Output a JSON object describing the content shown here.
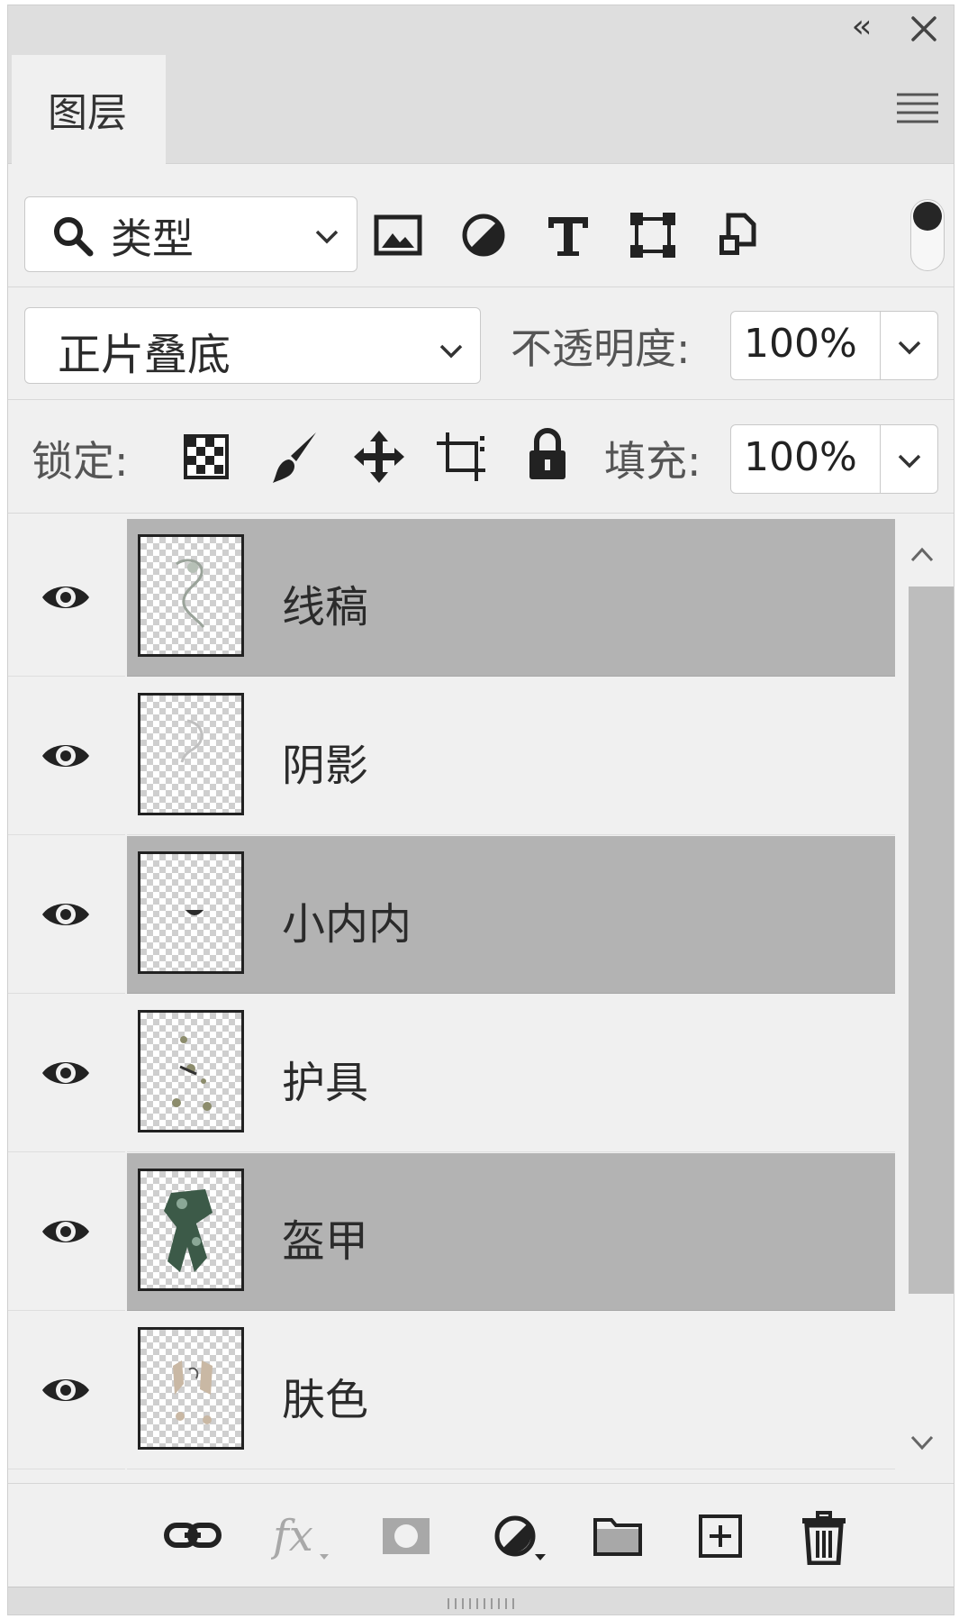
{
  "panel": {
    "collapse_icon": "double-chevron-left-icon",
    "close_icon": "close-icon",
    "tab_label": "图层",
    "menu_icon": "hamburger-menu-icon"
  },
  "filter": {
    "kind_label": "类型",
    "icons": [
      "image-filter-icon",
      "adjustment-filter-icon",
      "text-filter-icon",
      "shape-filter-icon",
      "smart-object-filter-icon"
    ],
    "toggle_on": true
  },
  "blend": {
    "mode": "正片叠底",
    "opacity_label": "不透明度:",
    "opacity_value": "100%"
  },
  "lock": {
    "label": "锁定:",
    "icons": [
      "lock-transparent-pixels-icon",
      "lock-image-pixels-icon",
      "lock-position-icon",
      "lock-artboard-icon",
      "lock-all-icon"
    ],
    "fill_label": "填充:",
    "fill_value": "100%"
  },
  "layers": [
    {
      "name": "线稿",
      "visible": true,
      "selected": true
    },
    {
      "name": "阴影",
      "visible": true,
      "selected": false
    },
    {
      "name": "小内内",
      "visible": true,
      "selected": true
    },
    {
      "name": "护具",
      "visible": true,
      "selected": false
    },
    {
      "name": "盔甲",
      "visible": true,
      "selected": true
    },
    {
      "name": "肤色",
      "visible": true,
      "selected": false
    }
  ],
  "bottom_toolbar": {
    "icons": [
      "link-layers-icon",
      "layer-style-fx-icon",
      "add-mask-icon",
      "new-adjustment-layer-icon",
      "new-group-folder-icon",
      "new-layer-icon",
      "delete-layer-icon"
    ]
  }
}
